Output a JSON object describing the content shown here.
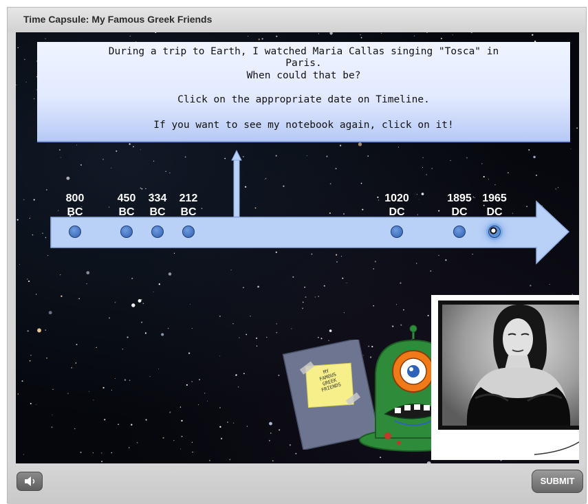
{
  "window": {
    "title": "Time Capsule: My Famous Greek Friends"
  },
  "message": {
    "lines": [
      "During a trip to Earth, I watched Maria Callas singing \"Tosca\" in",
      "Paris.",
      "When could that be?",
      "Click on the appropriate date on Timeline.",
      "If you want to see my notebook again, click on it!"
    ]
  },
  "timeline": {
    "dates": [
      {
        "year": "800",
        "era": "BC"
      },
      {
        "year": "450",
        "era": "BC"
      },
      {
        "year": "334",
        "era": "BC"
      },
      {
        "year": "212",
        "era": "BC"
      },
      {
        "year": "1020",
        "era": "DC"
      },
      {
        "year": "1895",
        "era": "DC"
      },
      {
        "year": "1965",
        "era": "DC"
      }
    ],
    "selected_index": 6
  },
  "notebook": {
    "note_lines": [
      "MY",
      "FAMOUS",
      "GREEK",
      "FRIENDS"
    ]
  },
  "photo": {
    "subject": "Maria Callas portrait (black and white)"
  },
  "controls": {
    "sound_icon": "speaker-icon",
    "submit_label": "SUBMIT"
  },
  "colors": {
    "message_box_top": "#f0f4ff",
    "message_box_bottom": "#b7c9f5",
    "timeline_arrow": "#b9d1f7",
    "timeline_dot": "#4a7cc9",
    "alien_body": "#2e8b3a",
    "alien_eye": "#f07a1a"
  }
}
